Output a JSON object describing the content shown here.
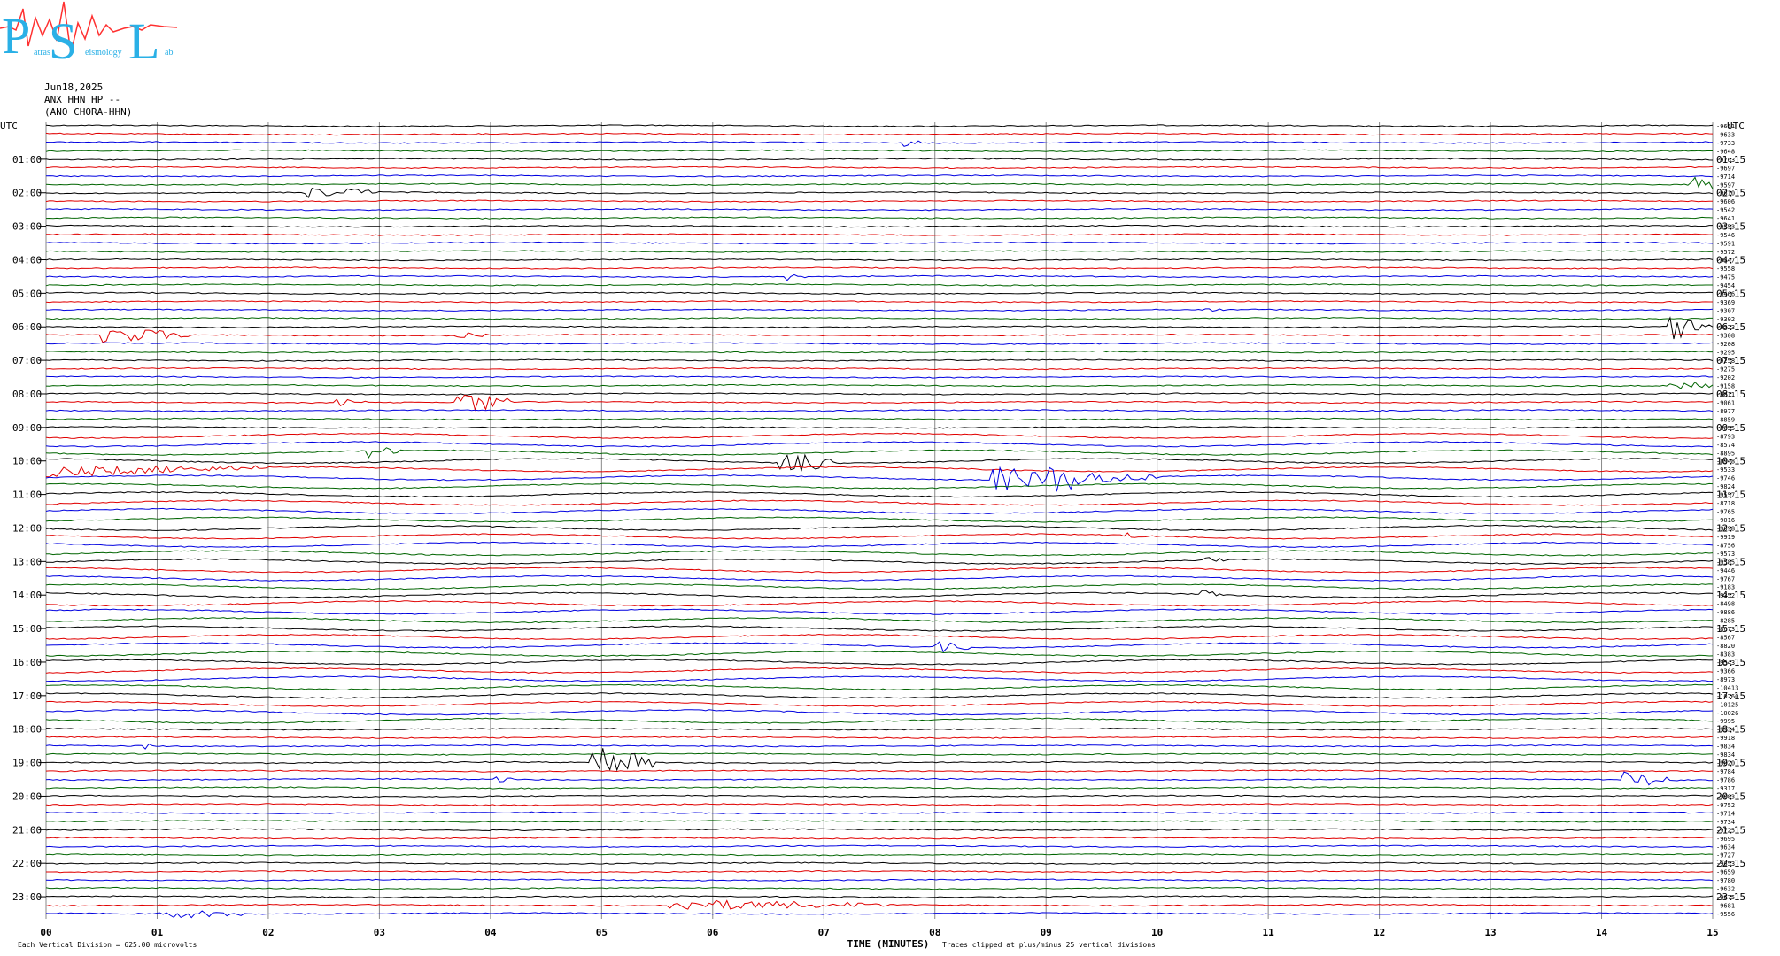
{
  "header": {
    "logo_letters": [
      "P",
      "S",
      "L"
    ],
    "logo_small_words": [
      "atras",
      "eismology",
      "ab"
    ],
    "date": "Jun18,2025",
    "station": "ANX HHN HP --",
    "sub": "(ANO CHORA-HHN)"
  },
  "chart_data": {
    "type": "line",
    "title": "",
    "xlabel": "TIME (MINUTES)",
    "xlim": [
      0,
      15
    ],
    "x_ticks": [
      "00",
      "01",
      "02",
      "03",
      "04",
      "05",
      "06",
      "07",
      "08",
      "09",
      "10",
      "11",
      "12",
      "13",
      "14",
      "15"
    ],
    "left_axis_label": "UTC",
    "right_axis_label": "UTC",
    "left_hours": [
      "01:00",
      "02:00",
      "03:00",
      "04:00",
      "05:00",
      "06:00",
      "07:00",
      "08:00",
      "09:00",
      "10:00",
      "11:00",
      "12:00",
      "13:00",
      "14:00",
      "15:00",
      "16:00",
      "17:00",
      "18:00",
      "19:00",
      "20:00",
      "21:00",
      "22:00",
      "23:00"
    ],
    "right_hours": [
      "01:15",
      "02:15",
      "03:15",
      "04:15",
      "05:15",
      "06:15",
      "07:15",
      "08:15",
      "09:15",
      "10:15",
      "11:15",
      "12:15",
      "13:15",
      "14:15",
      "15:15",
      "16:15",
      "17:15",
      "18:15",
      "19:15",
      "20:15",
      "21:15",
      "22:15",
      "23:15"
    ],
    "trace_colors": [
      "#000000",
      "#e00000",
      "#0000e0",
      "#006400"
    ],
    "trace_offsets": [
      "-9651",
      "-9633",
      "-9733",
      "-9648",
      "-9763",
      "-9697",
      "-9714",
      "-9597",
      "-9610",
      "-9606",
      "-9542",
      "-9641",
      "-9553",
      "-9546",
      "-9591",
      "-9572",
      "-9547",
      "-9558",
      "-9475",
      "-9454",
      "-9466",
      "-9369",
      "-9307",
      "-9302",
      "-9223",
      "-9308",
      "-9208",
      "-9295",
      "-9258",
      "-9275",
      "-9202",
      "-9158",
      "-9011",
      "-9061",
      "-8977",
      "-8859",
      "-8655",
      "-8793",
      "-8574",
      "-8895",
      "-8948",
      "-9533",
      "-9746",
      "-9824",
      "-9557",
      "-8718",
      "-9765",
      "-9016",
      "-9098",
      "-9919",
      "-8756",
      "-9573",
      "-9585",
      "-9446",
      "-9767",
      "-9183",
      "-9352",
      "-8498",
      "-9886",
      "-8285",
      "-8673",
      "-8567",
      "-8820",
      "-8383",
      "-9543",
      "-9366",
      "-8973",
      "-10413",
      "-10260",
      "-10125",
      "-10026",
      "-9995",
      "-9934",
      "-9918",
      "-9834",
      "-9834",
      "-9820",
      "-9784",
      "-9786",
      "-9317",
      "-9083",
      "-9752",
      "-9714",
      "-9734",
      "-9725",
      "-9695",
      "-9634",
      "-9727",
      "-9653",
      "-9659",
      "-9780",
      "-9632",
      "-9675",
      "-9681",
      "-9556"
    ],
    "events": [
      {
        "row": 2,
        "t": 7.7,
        "amp": 0.6,
        "len": 0.2
      },
      {
        "row": 8,
        "t": 2.3,
        "amp": 1.0,
        "len": 0.4
      },
      {
        "row": 8,
        "t": 2.7,
        "amp": 0.6,
        "len": 0.3
      },
      {
        "row": 7,
        "t": 14.8,
        "amp": 1.4,
        "len": 0.3
      },
      {
        "row": 18,
        "t": 6.6,
        "amp": 0.6,
        "len": 0.3
      },
      {
        "row": 22,
        "t": 10.4,
        "amp": 0.3,
        "len": 0.2
      },
      {
        "row": 25,
        "t": 0.5,
        "amp": 1.3,
        "len": 0.8
      },
      {
        "row": 25,
        "t": 3.7,
        "amp": 0.6,
        "len": 0.3
      },
      {
        "row": 24,
        "t": 14.6,
        "amp": 2.0,
        "len": 0.5
      },
      {
        "row": 33,
        "t": 3.7,
        "amp": 1.8,
        "len": 0.5
      },
      {
        "row": 33,
        "t": 2.6,
        "amp": 0.6,
        "len": 0.3
      },
      {
        "row": 31,
        "t": 14.6,
        "amp": 1.0,
        "len": 0.6
      },
      {
        "row": 39,
        "t": 2.9,
        "amp": 1.0,
        "len": 0.3
      },
      {
        "row": 41,
        "t": 0.0,
        "amp": 0.8,
        "len": 2.0
      },
      {
        "row": 40,
        "t": 6.6,
        "amp": 2.2,
        "len": 0.5
      },
      {
        "row": 42,
        "t": 8.5,
        "amp": 2.0,
        "len": 0.8
      },
      {
        "row": 42,
        "t": 9.0,
        "amp": 1.3,
        "len": 1.0
      },
      {
        "row": 49,
        "t": 9.7,
        "amp": 0.5,
        "len": 0.2
      },
      {
        "row": 52,
        "t": 10.4,
        "amp": 0.5,
        "len": 0.2
      },
      {
        "row": 56,
        "t": 10.4,
        "amp": 0.6,
        "len": 0.2
      },
      {
        "row": 62,
        "t": 8.0,
        "amp": 0.9,
        "len": 0.3
      },
      {
        "row": 76,
        "t": 4.9,
        "amp": 3.5,
        "len": 0.6
      },
      {
        "row": 74,
        "t": 0.8,
        "amp": 0.6,
        "len": 0.2
      },
      {
        "row": 78,
        "t": 14.2,
        "amp": 1.2,
        "len": 0.5
      },
      {
        "row": 78,
        "t": 4.0,
        "amp": 0.5,
        "len": 0.2
      },
      {
        "row": 93,
        "t": 5.6,
        "amp": 0.8,
        "len": 2.0
      },
      {
        "row": 94,
        "t": 1.0,
        "amp": 0.7,
        "len": 0.8
      }
    ],
    "footer_left": "Each Vertical Division = 625.00 microvolts",
    "footer_right": "Traces clipped at plus/minus 25 vertical divisions"
  }
}
